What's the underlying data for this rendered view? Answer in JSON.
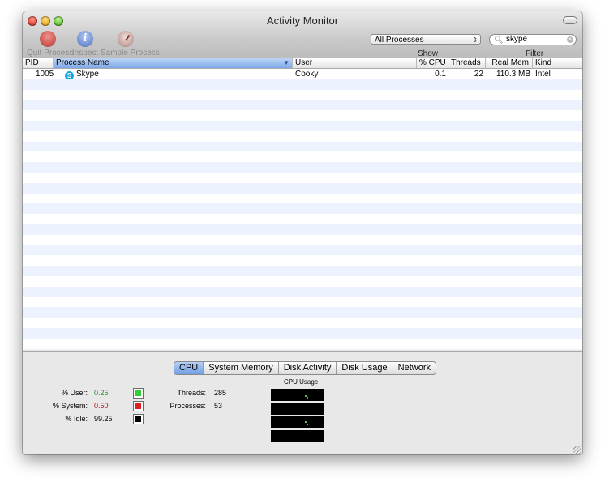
{
  "window": {
    "title": "Activity Monitor"
  },
  "toolbar": {
    "quit_label": "Quit Process",
    "inspect_label": "Inspect",
    "sample_label": "Sample Process",
    "show_label": "Show",
    "filter_label": "Filter",
    "process_select": "All Processes",
    "search_value": "skype",
    "inspect_glyph": "i"
  },
  "table": {
    "columns": [
      "PID",
      "Process Name",
      "User",
      "% CPU",
      "Threads",
      "Real Mem",
      "Kind"
    ],
    "rows": [
      {
        "pid": "1005",
        "name": "Skype",
        "user": "Cooky",
        "cpu": "0.1",
        "threads": "22",
        "mem": "110.3 MB",
        "kind": "Intel",
        "icon": "skype-icon"
      }
    ]
  },
  "tabs": [
    "CPU",
    "System Memory",
    "Disk Activity",
    "Disk Usage",
    "Network"
  ],
  "cpu_stats": {
    "user_label": "% User:",
    "user_value": "0.25",
    "system_label": "% System:",
    "system_value": "0.50",
    "idle_label": "% Idle:",
    "idle_value": "99.25",
    "threads_label": "Threads:",
    "threads_value": "285",
    "processes_label": "Processes:",
    "processes_value": "53",
    "usage_title": "CPU Usage"
  },
  "colors": {
    "user": "#2fd02f",
    "system": "#e02020",
    "idle": "#000000",
    "user_text": "#2a8a2a",
    "system_text": "#b01818",
    "selection": "#7fa9e8"
  }
}
